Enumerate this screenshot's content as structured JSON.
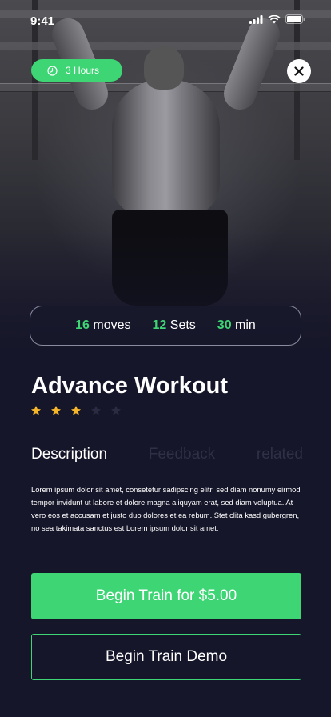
{
  "status_bar": {
    "time": "9:41"
  },
  "duration_pill": {
    "label": "3 Hours",
    "icon": "clock-icon"
  },
  "close_button": {
    "icon": "close-icon"
  },
  "stats": {
    "moves": {
      "value": "16",
      "unit": "moves"
    },
    "sets": {
      "value": "12",
      "unit": "Sets"
    },
    "time": {
      "value": "30",
      "unit": "min"
    }
  },
  "workout": {
    "title": "Advance Workout",
    "rating": {
      "value": 3,
      "max": 5
    }
  },
  "tabs": [
    {
      "label": "Description",
      "active": true
    },
    {
      "label": "Feedback",
      "active": false
    },
    {
      "label": "related",
      "active": false
    }
  ],
  "description": "Lorem ipsum dolor sit amet, consetetur sadipscing elitr, sed diam nonumy eirmod tempor invidunt ut labore et dolore magna aliquyam erat, sed diam voluptua. At vero eos et accusam et justo duo dolores et ea rebum. Stet clita kasd gubergren, no sea takimata sanctus est Lorem ipsum dolor sit amet.",
  "actions": {
    "primary": "Begin Train for $5.00",
    "secondary": "Begin Train Demo"
  },
  "colors": {
    "accent": "#3ed575",
    "background": "#16162a",
    "star_filled": "#f5b62a",
    "star_empty": "#2a2b40"
  }
}
